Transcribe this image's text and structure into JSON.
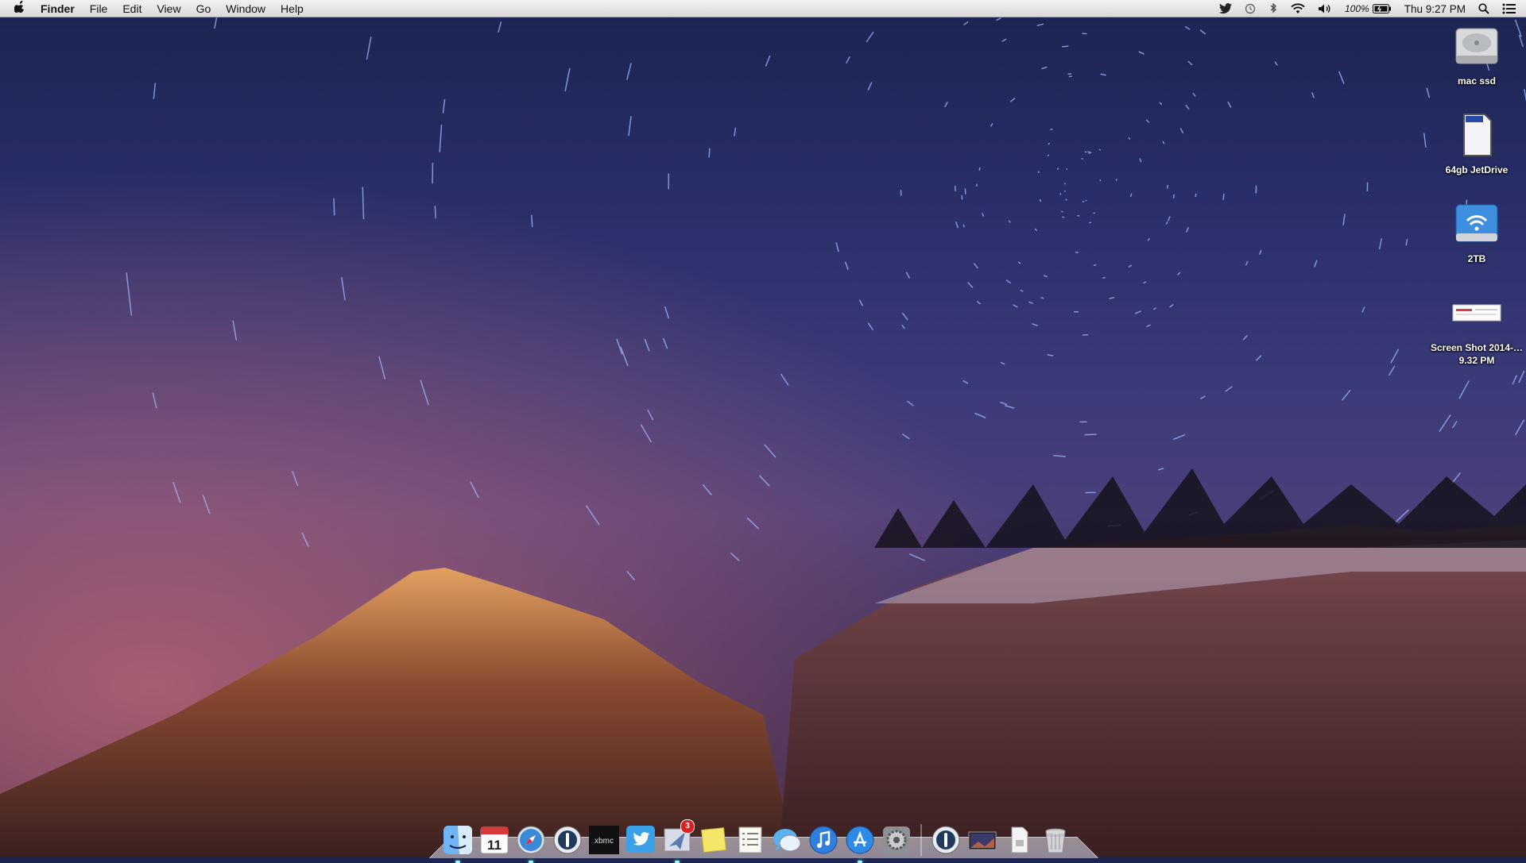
{
  "menubar": {
    "apple_icon": "apple-logo-icon",
    "app_name": "Finder",
    "menus": [
      "File",
      "Edit",
      "View",
      "Go",
      "Window",
      "Help"
    ],
    "status_icons": [
      "twitter-icon",
      "time-machine-icon",
      "bluetooth-icon",
      "wifi-icon",
      "volume-icon"
    ],
    "battery_percent": "100%",
    "clock": "Thu 9:27 PM",
    "spotlight_icon": "search-icon",
    "notification_icon": "list-icon"
  },
  "desktop_icons": [
    {
      "label": "mac ssd",
      "icon": "hard-drive-icon"
    },
    {
      "label": "64gb JetDrive",
      "icon": "sd-card-icon"
    },
    {
      "label": "2TB",
      "icon": "network-drive-icon"
    },
    {
      "label": "Screen Shot 2014-…9.32 PM",
      "icon": "screenshot-file-icon"
    }
  ],
  "dock": {
    "apps": [
      {
        "name": "Finder",
        "icon": "finder-icon"
      },
      {
        "name": "Calendar",
        "icon": "calendar-icon",
        "day": "11"
      },
      {
        "name": "Safari",
        "icon": "safari-icon"
      },
      {
        "name": "1Password",
        "icon": "password-icon"
      },
      {
        "name": "XBMC",
        "icon": "xbmc-icon",
        "text": "xbmc"
      },
      {
        "name": "Twitter",
        "icon": "twitter-icon"
      },
      {
        "name": "Mail",
        "icon": "mail-icon",
        "badge": "3"
      },
      {
        "name": "Stickies",
        "icon": "stickies-icon"
      },
      {
        "name": "Reminders",
        "icon": "reminders-icon"
      },
      {
        "name": "Messages",
        "icon": "messages-icon"
      },
      {
        "name": "iTunes",
        "icon": "itunes-icon"
      },
      {
        "name": "App Store",
        "icon": "app-store-icon"
      },
      {
        "name": "System Preferences",
        "icon": "system-preferences-icon"
      }
    ],
    "stacks": [
      {
        "name": "1Password mini",
        "icon": "password-icon"
      },
      {
        "name": "Desktop",
        "icon": "desktop-folder-icon"
      },
      {
        "name": "Documents",
        "icon": "document-icon"
      },
      {
        "name": "Trash",
        "icon": "trash-icon"
      }
    ]
  },
  "colors": {
    "sky_top": "#1b2450",
    "menubar": "#e8e8e8",
    "mountain": "#c06a3a"
  }
}
